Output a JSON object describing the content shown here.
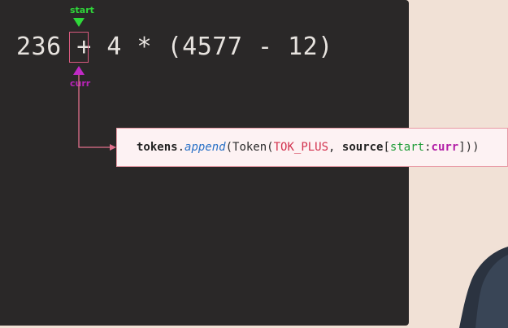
{
  "expression": {
    "before": "236 ",
    "token": "+",
    "after": " 4 * (4577 - 12)"
  },
  "pointers": {
    "start_label": "start",
    "curr_label": "curr"
  },
  "code": {
    "tokens": "tokens",
    "dot": ".",
    "append": "append",
    "open": "(Token(",
    "tok_plus": "TOK_PLUS",
    "comma": ", ",
    "source": "source",
    "bracket_open": "[",
    "start": "start",
    "colon": ":",
    "curr": "curr",
    "close": "]))"
  },
  "colors": {
    "start": "#2fd83a",
    "curr": "#b723b6",
    "box": "#d85a7f",
    "editor_bg": "#2a2828",
    "page_bg": "#f1e1d6"
  }
}
